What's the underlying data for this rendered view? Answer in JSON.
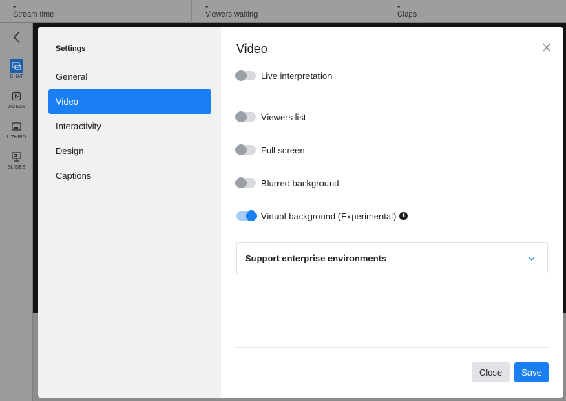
{
  "stats": [
    {
      "value": "-",
      "label": "Stream time"
    },
    {
      "value": "-",
      "label": "Viewers waiting"
    },
    {
      "value": "-",
      "label": "Claps"
    }
  ],
  "rail": {
    "items": [
      {
        "label": "CHAT",
        "icon": "chat-icon"
      },
      {
        "label": "VIDEOS",
        "icon": "video-icon"
      },
      {
        "label": "L.THIRD",
        "icon": "lower-third-icon"
      },
      {
        "label": "SLIDES",
        "icon": "slides-icon"
      }
    ]
  },
  "settings": {
    "title": "Settings",
    "nav": [
      "General",
      "Video",
      "Interactivity",
      "Design",
      "Captions"
    ],
    "active": "Video"
  },
  "video": {
    "title": "Video",
    "options": [
      {
        "label": "Live interpretation",
        "on": false
      },
      {
        "label": "Viewers list",
        "on": false
      },
      {
        "label": "Full screen",
        "on": false
      },
      {
        "label": "Blurred background",
        "on": false
      },
      {
        "label": "Virtual background (Experimental)",
        "on": true
      }
    ],
    "accordion_label": "Support enterprise environments"
  },
  "footer": {
    "close_label": "Close",
    "save_label": "Save"
  },
  "colors": {
    "accent": "#1a7ff2"
  }
}
